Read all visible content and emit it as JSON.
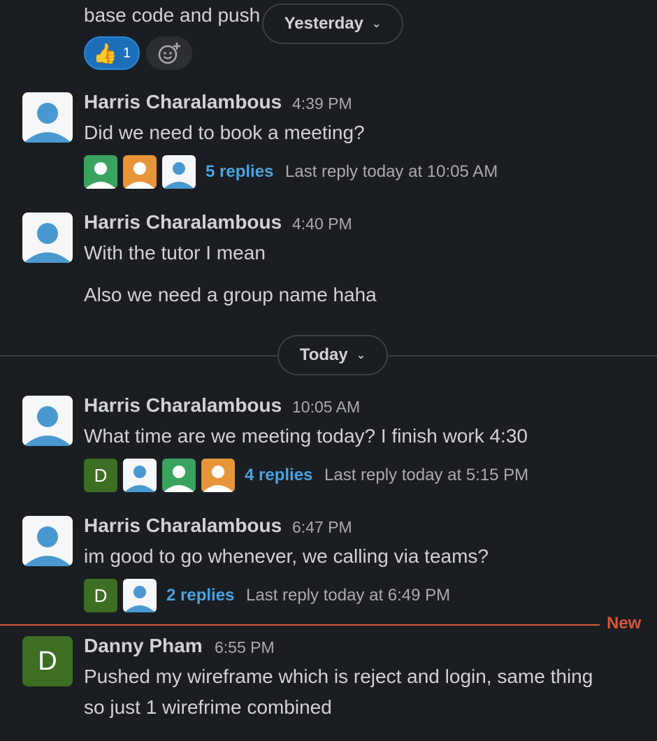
{
  "top": {
    "partial_text": "base code and push",
    "reaction_emoji": "👍",
    "reaction_count": "1"
  },
  "dividers": {
    "yesterday_label": "Yesterday",
    "today_label": "Today",
    "new_label": "New"
  },
  "messages": [
    {
      "author": "Harris Charalambous",
      "time": "4:39 PM",
      "lines": [
        "Did we need to book a meeting?"
      ],
      "replies": "5 replies",
      "last_reply": "Last reply today at 10:05 AM"
    },
    {
      "author": "Harris Charalambous",
      "time": "4:40 PM",
      "lines": [
        "With the tutor I mean",
        "Also we need a group name haha"
      ]
    },
    {
      "author": "Harris Charalambous",
      "time": "10:05 AM",
      "lines": [
        "What time are we meeting today? I finish work 4:30"
      ],
      "replies": "4 replies",
      "last_reply": "Last reply today at 5:15 PM"
    },
    {
      "author": "Harris Charalambous",
      "time": "6:47 PM",
      "lines": [
        "im good to go whenever, we calling via teams?"
      ],
      "replies": "2 replies",
      "last_reply": "Last reply today at 6:49 PM"
    },
    {
      "author": "Danny Pham",
      "time": "6:55 PM",
      "avatar_letter": "D",
      "lines": [
        "Pushed my wireframe which is reject and login, same thing",
        "so just 1 wirefrime combined"
      ]
    }
  ],
  "colors": {
    "background": "#1a1d21",
    "link": "#4aa3df",
    "new_marker": "#d5573b",
    "avatar_blue": "#4a98d0",
    "avatar_green": "#3aa360",
    "avatar_orange": "#e8953a",
    "avatar_dark_green": "#3c6e23"
  }
}
